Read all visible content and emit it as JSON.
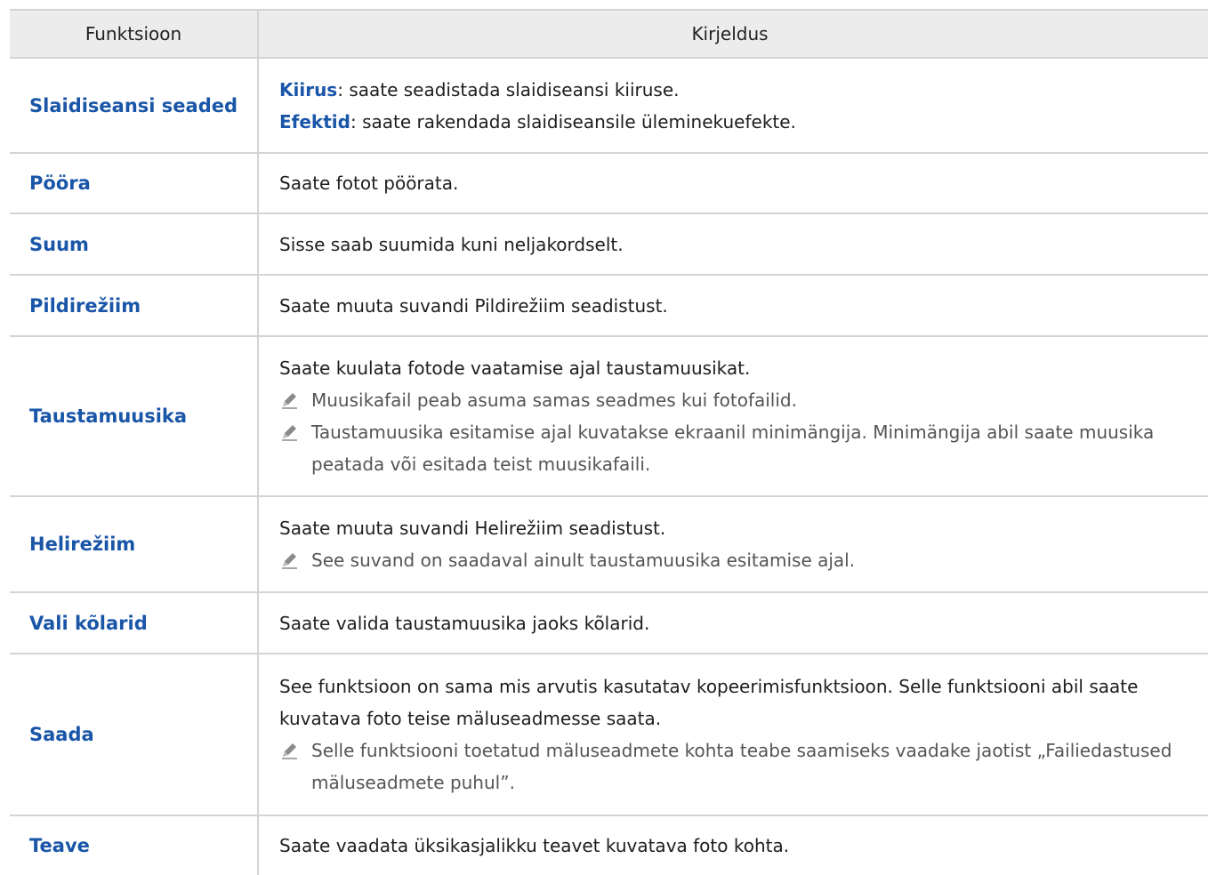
{
  "header": {
    "col1": "Funktsioon",
    "col2": "Kirjeldus"
  },
  "rows": [
    {
      "func": "Slaidiseansi seaded",
      "l1_label": "Kiirus",
      "l1_text": ": saate seadistada slaidiseansi kiiruse.",
      "l2_label": "Efektid",
      "l2_text": ": saate rakendada slaidiseansile üleminekuefekte."
    },
    {
      "func": "Pööra",
      "text": "Saate fotot pöörata."
    },
    {
      "func": "Suum",
      "text": "Sisse saab suumida kuni neljakordselt."
    },
    {
      "func": "Pildirežiim",
      "text": "Saate muuta suvandi Pildirežiim seadistust."
    },
    {
      "func": "Taustamuusika",
      "text": "Saate kuulata fotode vaatamise ajal taustamuusikat.",
      "note1": "Muusikafail peab asuma samas seadmes kui fotofailid.",
      "note2": "Taustamuusika esitamise ajal kuvatakse ekraanil minimängija. Minimängija abil saate muusika peatada või esitada teist muusikafaili."
    },
    {
      "func": "Helirežiim",
      "text": "Saate muuta suvandi Helirežiim seadistust.",
      "note1": "See suvand on saadaval ainult taustamuusika esitamise ajal."
    },
    {
      "func": "Vali kõlarid",
      "text": "Saate valida taustamuusika jaoks kõlarid."
    },
    {
      "func": "Saada",
      "text": "See funktsioon on sama mis arvutis kasutatav kopeerimisfunktsioon. Selle funktsiooni abil saate kuvatava foto teise mäluseadmesse saata.",
      "note1": "Selle funktsiooni toetatud mäluseadmete kohta teabe saamiseks vaadake jaotist „Failiedastused mäluseadmete puhul”."
    },
    {
      "func": "Teave",
      "text": "Saate vaadata üksikasjalikku teavet kuvatava foto kohta."
    }
  ],
  "icons": {
    "note": "pencil-icon"
  },
  "colors": {
    "accent": "#1a56a8",
    "header_bg": "#ececec",
    "border": "#d4d4d4"
  }
}
